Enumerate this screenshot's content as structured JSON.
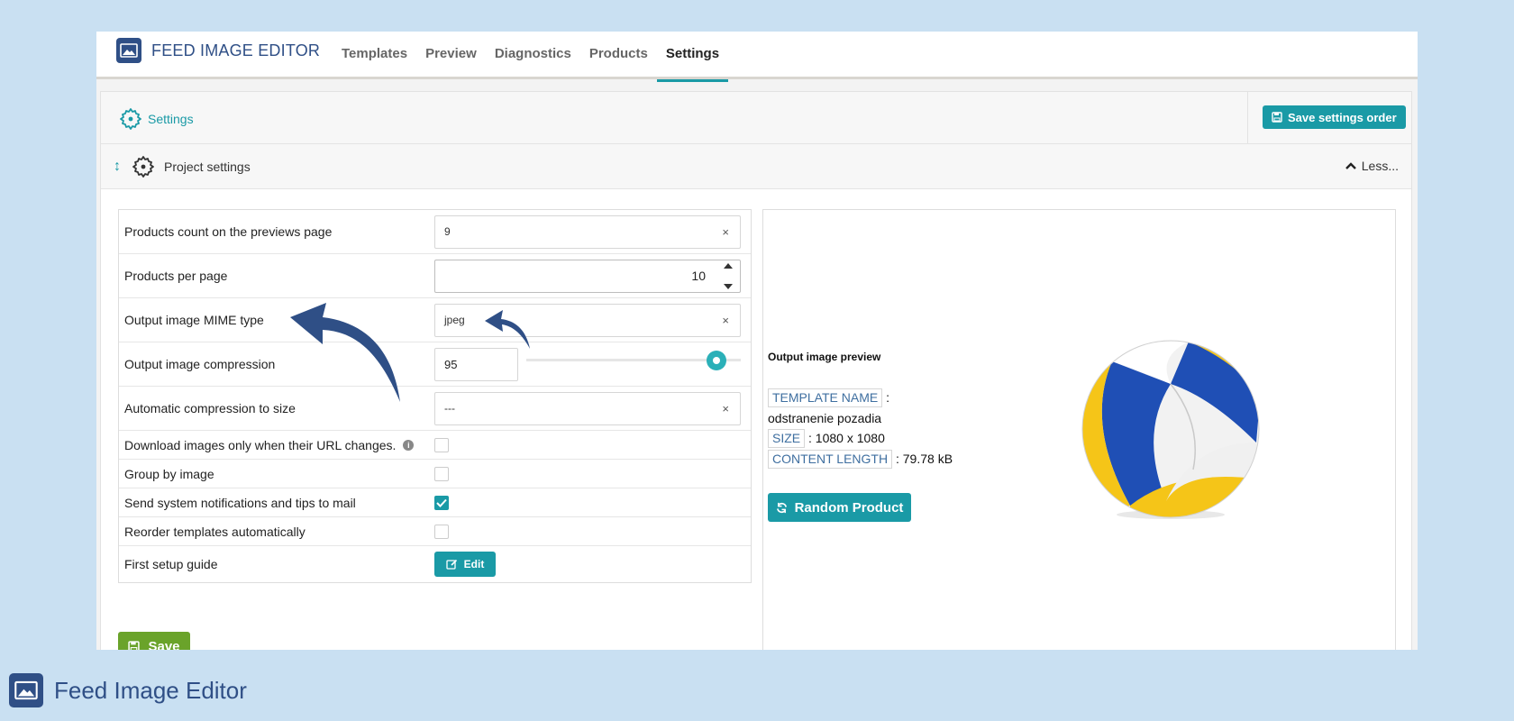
{
  "app": {
    "brand_title": "FEED IMAGE EDITOR",
    "nav_tabs": [
      "Templates",
      "Preview",
      "Diagnostics",
      "Products",
      "Settings"
    ],
    "active_tab": "Settings"
  },
  "settings_header": {
    "title": "Settings",
    "save_order_label": "Save settings order"
  },
  "project_header": {
    "title": "Project settings",
    "toggle_label": "Less..."
  },
  "form": {
    "rows": [
      {
        "label": "Products count on the previews page",
        "value": "9"
      },
      {
        "label": "Products per page",
        "value": "10"
      },
      {
        "label": "Output image MIME type",
        "value": "jpeg"
      },
      {
        "label": "Output image compression",
        "value": "95",
        "slider_fraction": 1.0
      },
      {
        "label": "Automatic compression to size",
        "value": "---"
      },
      {
        "label": "Download images only when their URL changes.",
        "checked": false
      },
      {
        "label": "Group by image",
        "checked": false
      },
      {
        "label": "Send system notifications and tips to mail",
        "checked": true
      },
      {
        "label": "Reorder templates automatically",
        "checked": false
      },
      {
        "label": "First setup guide",
        "button": "Edit"
      }
    ],
    "save_label": "Save"
  },
  "preview": {
    "title": "Output image preview",
    "template_name_tag": "TEMPLATE NAME",
    "template_name_value": "odstranenie pozadia",
    "size_tag": "SIZE",
    "size_value": ": 1080 x 1080",
    "content_length_tag": "CONTENT LENGTH",
    "content_length_value": ": 79.78 kB",
    "random_button": "Random Product"
  },
  "footer": {
    "title": "Feed Image Editor"
  },
  "colors": {
    "accent": "#1a9aa6",
    "brand": "#2f4f86",
    "save_green": "#6aa32a",
    "background": "#c9e0f2"
  }
}
